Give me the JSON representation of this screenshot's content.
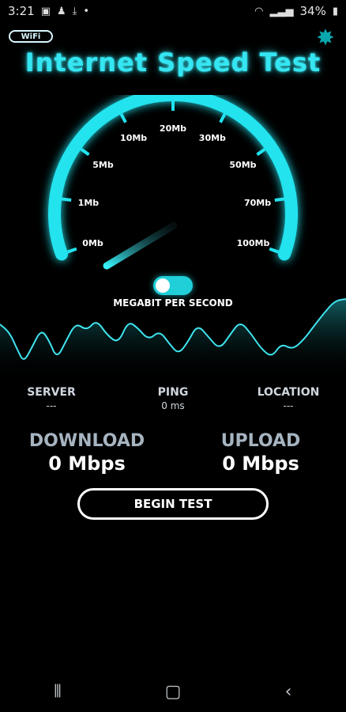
{
  "statusbar": {
    "time": "3:21",
    "battery": "34%",
    "icons_left": [
      "image-icon",
      "person-icon",
      "download-icon",
      "dot-icon"
    ],
    "icons_right": [
      "wifi-icon",
      "signal-icon",
      "battery-icon"
    ]
  },
  "header": {
    "badge": "WiFi",
    "title": "Internet Speed Test",
    "star_icon": "star-icon"
  },
  "gauge": {
    "tick_labels": [
      "0Mb",
      "1Mb",
      "5Mb",
      "10Mb",
      "20Mb",
      "30Mb",
      "50Mb",
      "70Mb",
      "100Mb"
    ],
    "unit_label": "MEGABIT PER SECOND",
    "needle_value": 0,
    "accent_color": "#22e3ee"
  },
  "toggle": {
    "on": true
  },
  "stats": {
    "server": {
      "label": "SERVER",
      "value": "---"
    },
    "ping": {
      "label": "PING",
      "value": "0 ms"
    },
    "location": {
      "label": "LOCATION",
      "value": "---"
    }
  },
  "download": {
    "label": "DOWNLOAD",
    "value": "0 Mbps"
  },
  "upload": {
    "label": "UPLOAD",
    "value": "0 Mbps"
  },
  "begin_button": {
    "label": "BEGIN TEST"
  },
  "navbar": {
    "recent": "recent-apps-icon",
    "home": "home-icon",
    "back": "back-icon"
  }
}
